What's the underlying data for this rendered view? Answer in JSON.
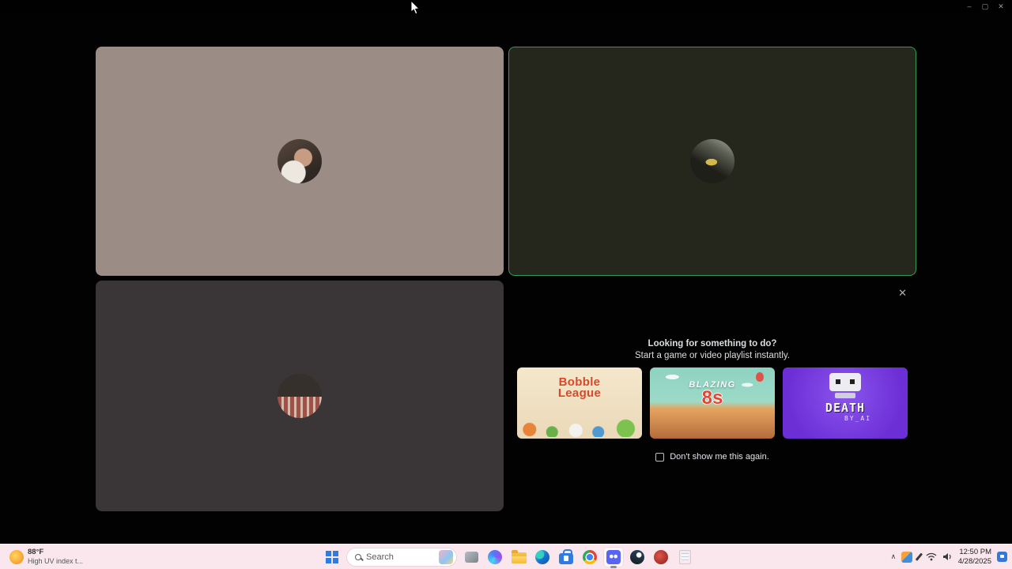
{
  "titlebar": {
    "minimize_icon": "–",
    "maximize_icon": "▢",
    "close_icon": "✕"
  },
  "call": {
    "promo": {
      "close_icon": "✕",
      "heading_line1": "Looking for something to do?",
      "heading_line2": "Start a game or video playlist instantly.",
      "games": [
        {
          "name": "Bobble League",
          "line1": "Bobble",
          "line2": "League"
        },
        {
          "name": "Blazing 8s",
          "line1": "BLAZING",
          "line2": "8s"
        },
        {
          "name": "Death by AI",
          "line1": "DEATH",
          "line2": "BY_AI"
        }
      ],
      "dismiss_label": "Don't show me this again."
    }
  },
  "taskbar": {
    "weather": {
      "temp": "88°F",
      "desc": "High UV index t..."
    },
    "search": {
      "placeholder": "Search"
    },
    "tray": {
      "expand_icon": "∧",
      "time": "12:50 PM",
      "date": "4/28/2025"
    }
  },
  "colors": {
    "speaking_border_green": "#2f9e5b",
    "tile1_bg": "#9b8d86",
    "tile2_bg": "#25271d",
    "tile3_bg": "#3a3637",
    "taskbar_bg": "#fae7ee",
    "discord_blurple": "#5865f2"
  }
}
